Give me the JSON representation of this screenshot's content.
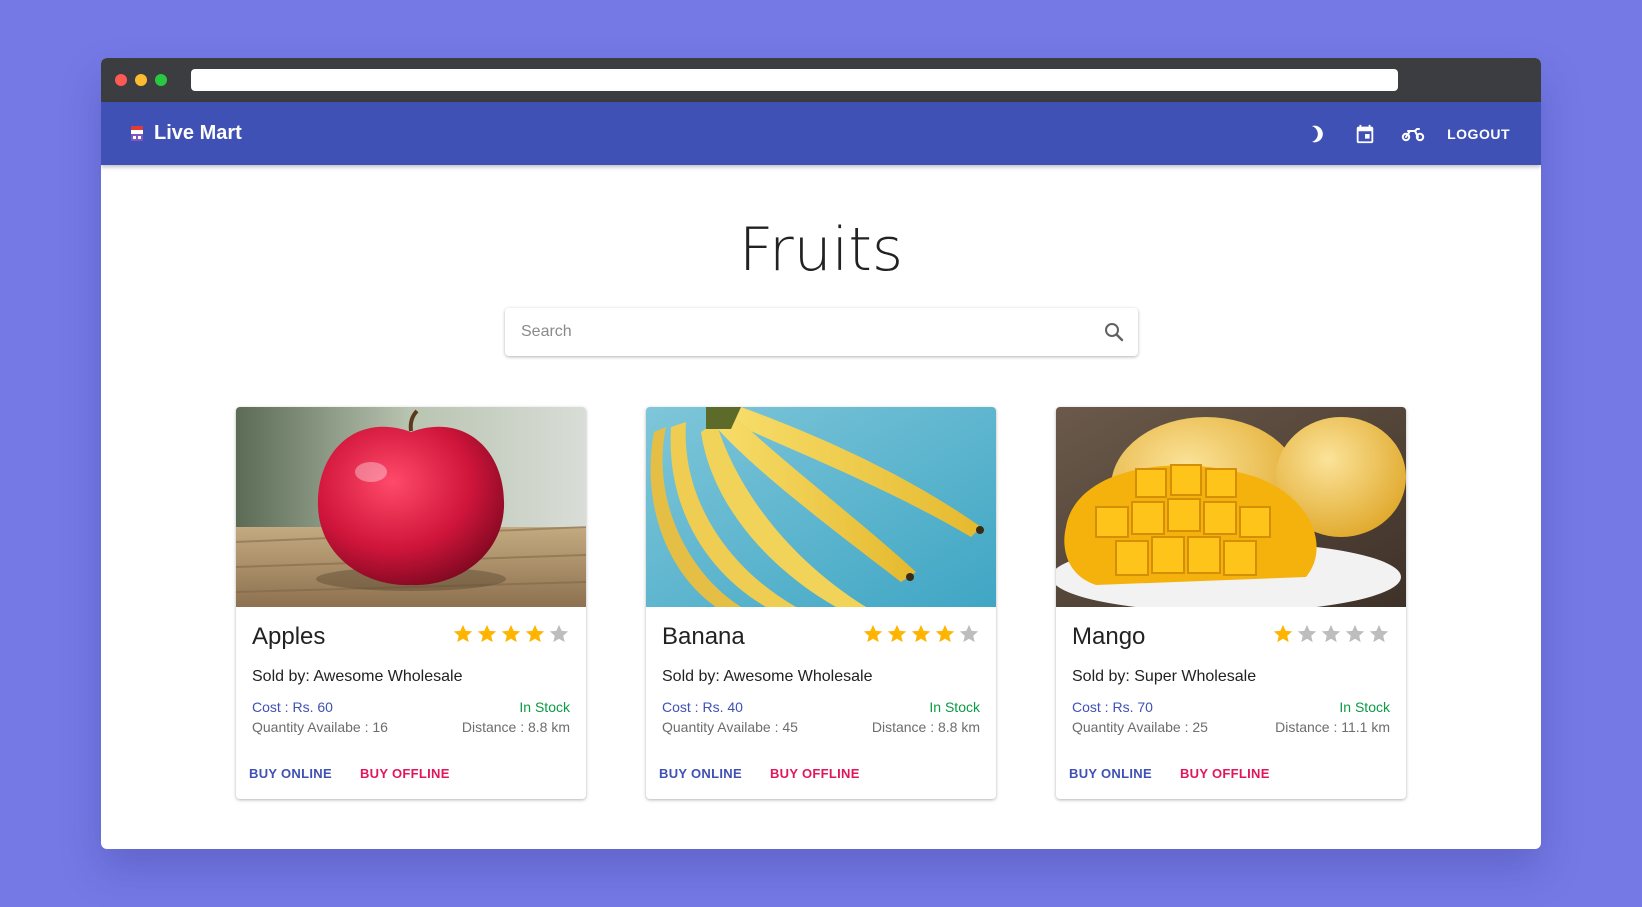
{
  "appbar": {
    "title": "Live Mart",
    "icons": [
      "dark-mode-icon",
      "calendar-icon",
      "delivery-bike-icon"
    ],
    "logout_label": "LOGOUT",
    "color": "#3f51b5"
  },
  "page": {
    "title": "Fruits"
  },
  "search": {
    "placeholder": "Search",
    "value": ""
  },
  "products": [
    {
      "name": "Apples",
      "rating": 4,
      "max_rating": 5,
      "seller": "Sold by: Awesome Wholesale",
      "cost": "Cost : Rs. 60",
      "stock": "In Stock",
      "quantity": "Quantity Availabe : 16",
      "distance": "Distance : 8.8 km",
      "buy_online": "BUY ONLINE",
      "buy_offline": "BUY OFFLINE"
    },
    {
      "name": "Banana",
      "rating": 4,
      "max_rating": 5,
      "seller": "Sold by: Awesome Wholesale",
      "cost": "Cost : Rs. 40",
      "stock": "In Stock",
      "quantity": "Quantity Availabe : 45",
      "distance": "Distance : 8.8 km",
      "buy_online": "BUY ONLINE",
      "buy_offline": "BUY OFFLINE"
    },
    {
      "name": "Mango",
      "rating": 1,
      "max_rating": 5,
      "seller": "Sold by: Super Wholesale",
      "cost": "Cost : Rs. 70",
      "stock": "In Stock",
      "quantity": "Quantity Availabe : 25",
      "distance": "Distance : 11.1 km",
      "buy_online": "BUY ONLINE",
      "buy_offline": "BUY OFFLINE"
    }
  ],
  "colors": {
    "background": "#7479e6",
    "star_filled": "#ffb400",
    "star_empty": "#bdbdbd",
    "buy_offline": "#e2175b",
    "in_stock": "#0b9a45"
  }
}
